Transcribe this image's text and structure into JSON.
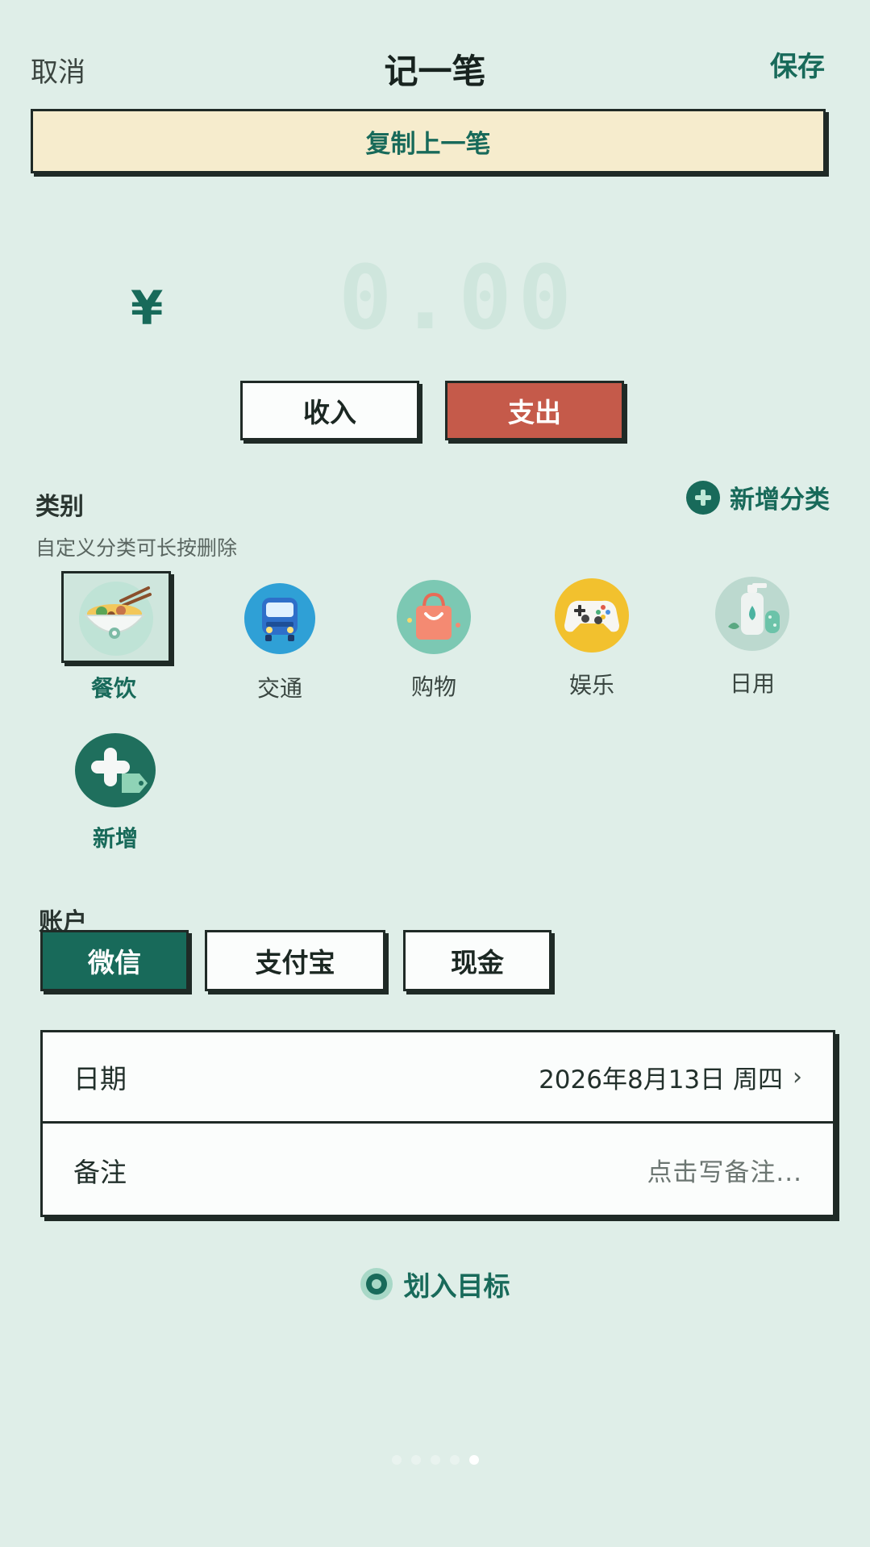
{
  "header": {
    "cancel_label": "取消",
    "title": "记一笔",
    "save_label": "保存"
  },
  "copy_last_label": "复制上一笔",
  "amount": {
    "currency_symbol": "¥",
    "value": "0.00"
  },
  "type_toggle": {
    "income_label": "收入",
    "expense_label": "支出",
    "selected": "expense"
  },
  "category": {
    "title": "类别",
    "hint": "自定义分类可长按删除",
    "add_label": "新增分类",
    "items": [
      {
        "label": "餐饮",
        "icon": "noodle-bowl-icon",
        "selected": true
      },
      {
        "label": "交通",
        "icon": "bus-icon",
        "selected": false
      },
      {
        "label": "购物",
        "icon": "shopping-bag-icon",
        "selected": false
      },
      {
        "label": "娱乐",
        "icon": "game-controller-icon",
        "selected": false
      },
      {
        "label": "日用",
        "icon": "soap-bottle-icon",
        "selected": false
      },
      {
        "label": "新增",
        "icon": "add-category-icon",
        "selected": false
      }
    ]
  },
  "account": {
    "title": "账户",
    "options": [
      "微信",
      "支付宝",
      "现金"
    ],
    "selected": "微信"
  },
  "details": {
    "date_label": "日期",
    "date_value": "2026年8月13日  周四",
    "note_label": "备注",
    "note_placeholder": "点击写备注..."
  },
  "goal_label": "划入目标",
  "pagination": {
    "total": 5,
    "active": 5
  },
  "colors": {
    "background": "#dfeee8",
    "brand_green": "#186a5a",
    "expense_red": "#c55a4a",
    "copy_bg": "#f6eccd"
  }
}
